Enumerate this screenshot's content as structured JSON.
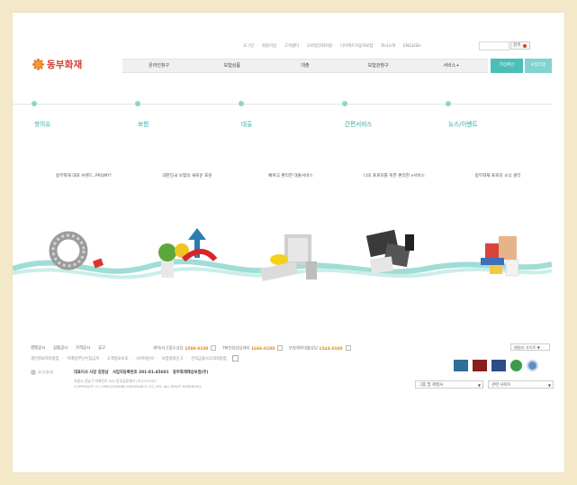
{
  "util": {
    "links": [
      "로그인",
      "회원가입",
      "고객센터",
      "모바일전화지원",
      "다이렉트자동차보험",
      "회사소개",
      "ENGLISH"
    ],
    "search_button": "검색"
  },
  "logo": {
    "text": "동부화재"
  },
  "gnb": [
    "온라인창구",
    "보험상품",
    "대출",
    "보험관창구",
    "서비스+"
  ],
  "top_buttons": {
    "login": "가입확인",
    "join": "보험가입"
  },
  "categories": [
    {
      "title": "핫이슈",
      "desc": "동부화재 대표 브랜드, PROMY!"
    },
    {
      "title": "보험",
      "desc": "대한민국 보험의 새로운 표준"
    },
    {
      "title": "대출",
      "desc": "빠르고 편리한 대출서비스"
    },
    {
      "title": "간편서비스",
      "desc": "나의 프로미를 위한 편리한 e서비스"
    },
    {
      "title": "뉴스/이벤트",
      "desc": "동부화재 프로미 소식 센터"
    }
  ],
  "footer": {
    "links": [
      "경영공시",
      "상품공시",
      "가격공시",
      "공고"
    ],
    "phones": [
      {
        "label": "계약/사고접수상담",
        "number": "1588-0100"
      },
      {
        "label": "TM전화상담센터",
        "number": "1666-0100"
      },
      {
        "label": "보험계약대출상담",
        "number": "1544-0100"
      }
    ],
    "family_site": "패밀리 사이트 ▼",
    "sub_links": [
      "개인정보처리방침",
      "이메일무단수집금지",
      "고객정보보호",
      "사이버감사",
      "보험범죄신고",
      "전자금융사고대처방법"
    ],
    "brand": "동부화재",
    "corp_name": "대표이사 사장 김정남",
    "corp_reg": "사업자등록번호 201-81-45601",
    "corp_company": "동부화재해상보험(주)",
    "address_line": "서울시 강남구 테헤란로 432 동부금융센터 (우)135-523",
    "copyright": "COPYRIGHT (C) 1998 DONGBU INSURANCE CO.,LTD. ALL RIGHT RESERVED.",
    "group_select": "그룹 및 계열사",
    "related_select": "관련 사이트"
  },
  "colors": {
    "accent": "#5dc4c1",
    "brand_red": "#d23a2e",
    "brand_orange": "#f07d22"
  }
}
